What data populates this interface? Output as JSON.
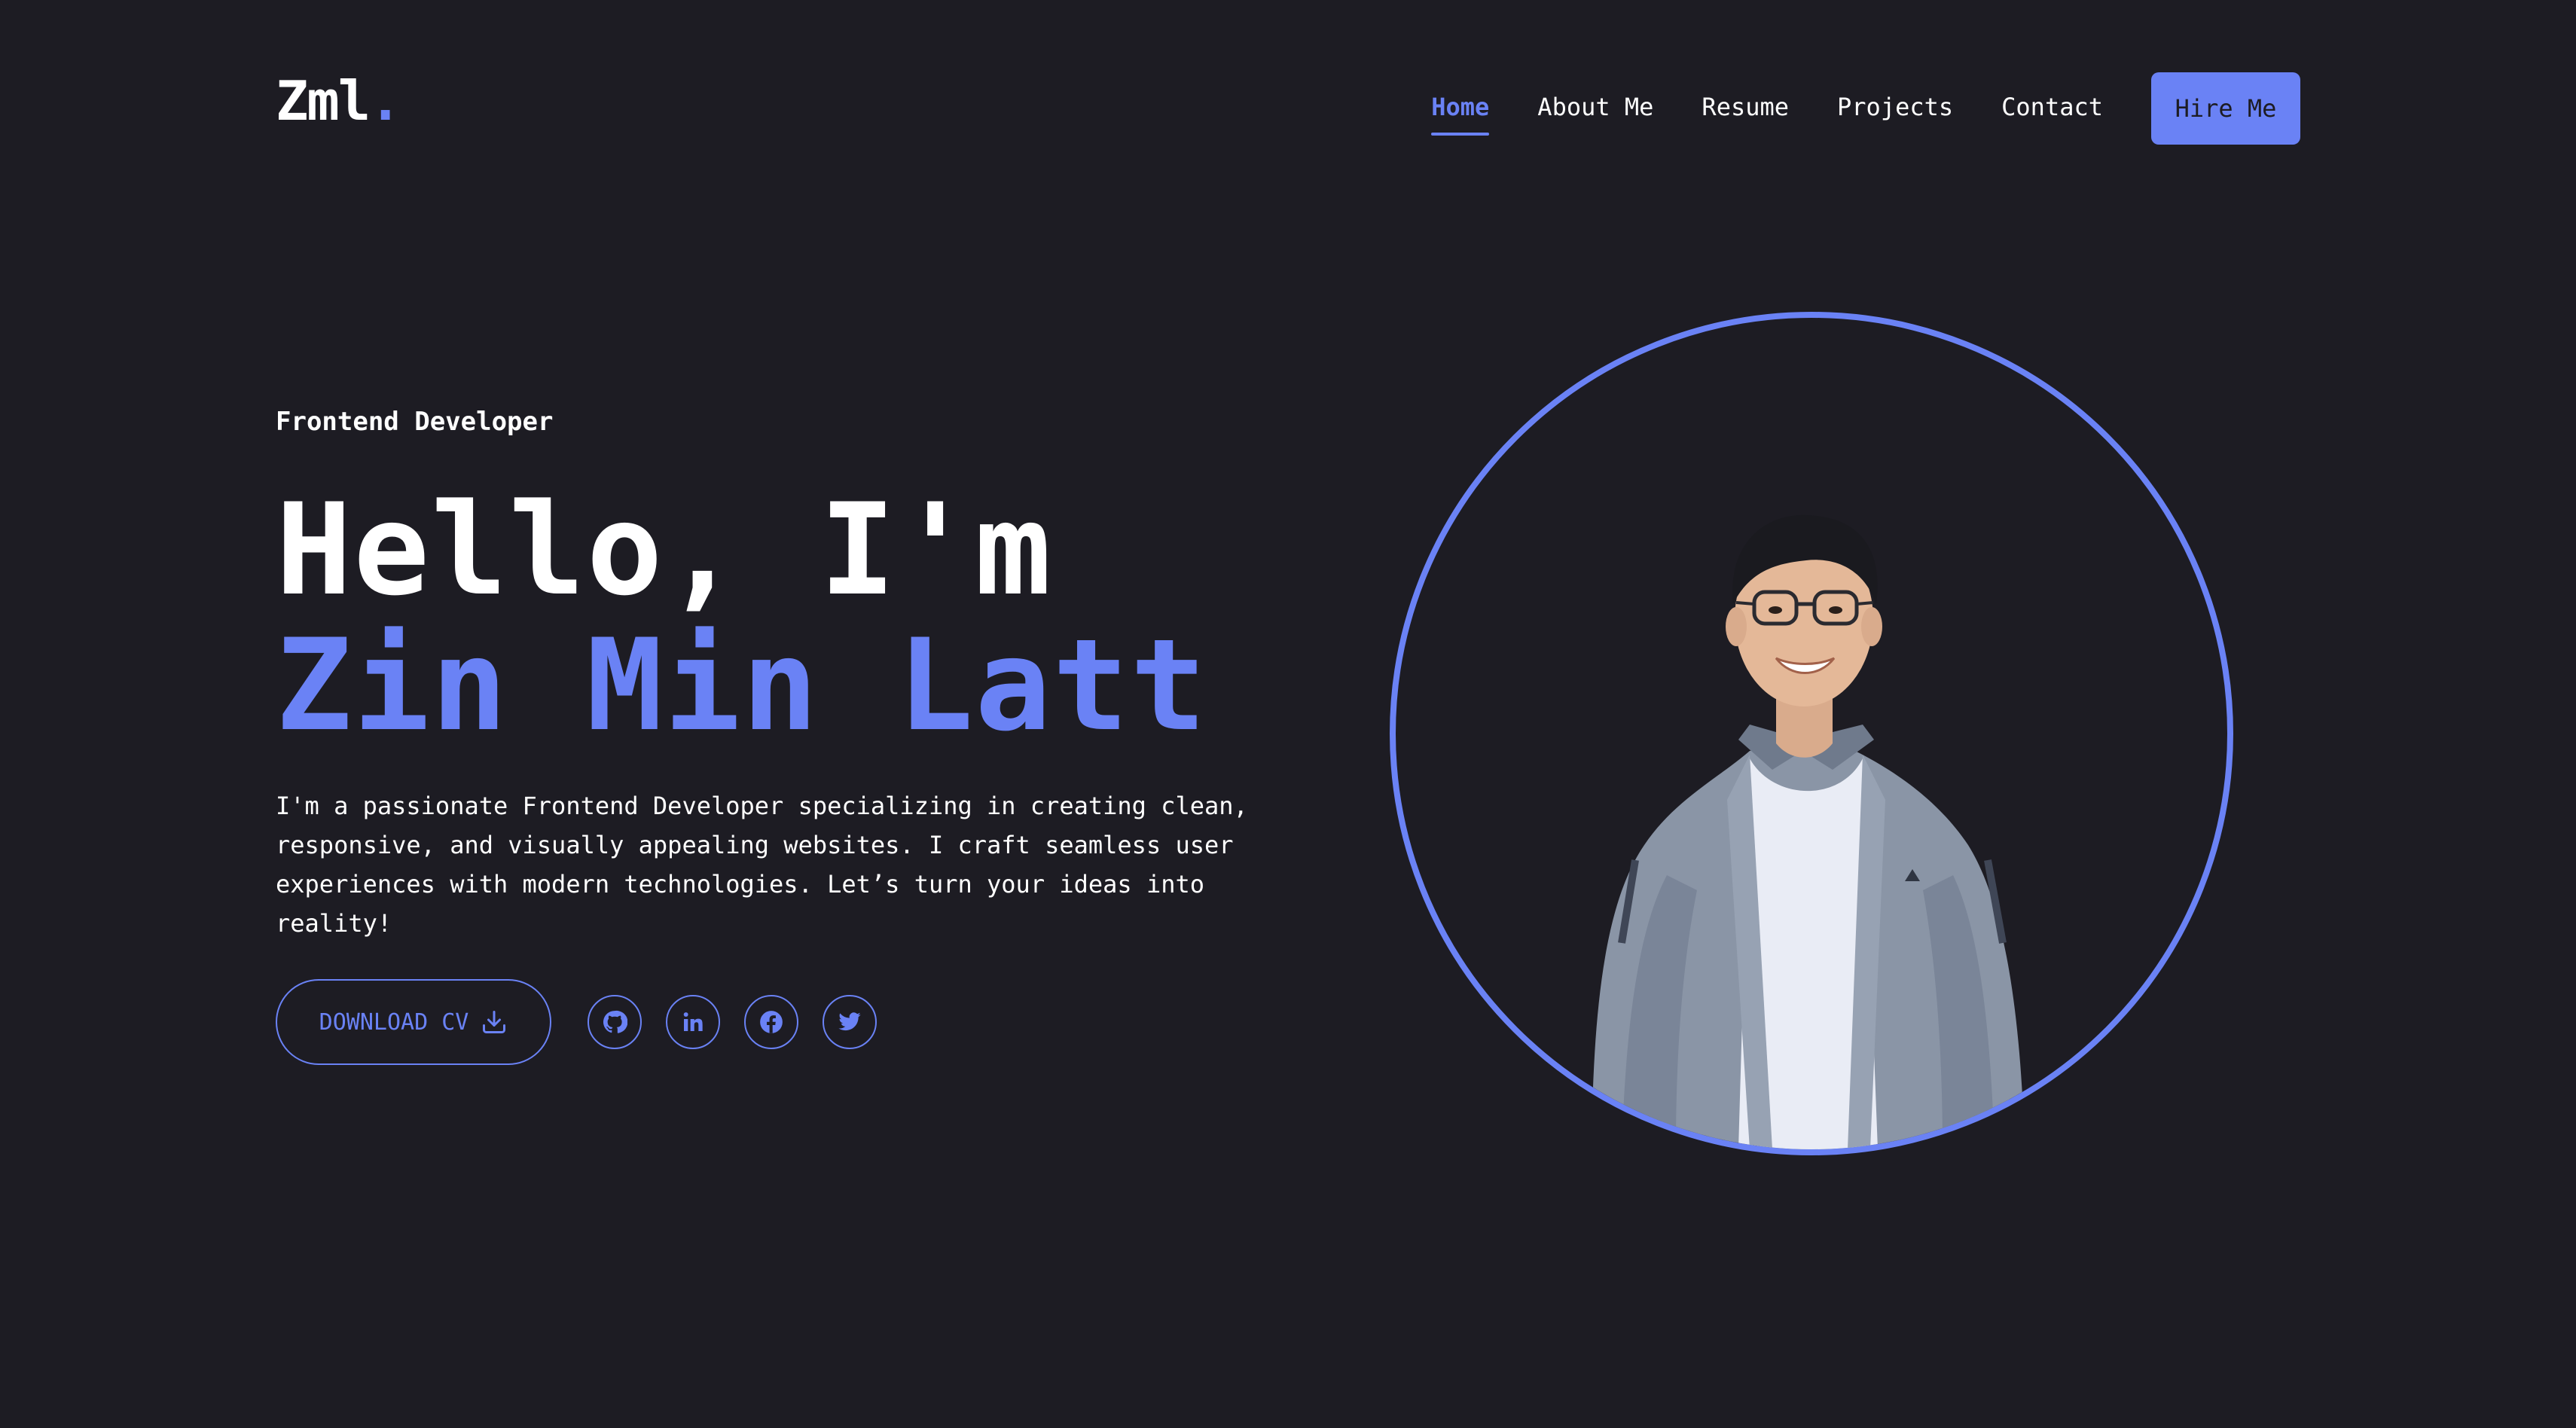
{
  "brand": {
    "name": "Zml",
    "dot": "."
  },
  "nav": {
    "items": [
      {
        "label": "Home",
        "active": true
      },
      {
        "label": "About Me"
      },
      {
        "label": "Resume"
      },
      {
        "label": "Projects"
      },
      {
        "label": "Contact"
      }
    ],
    "cta": "Hire Me"
  },
  "hero": {
    "role": "Frontend Developer",
    "greeting": "Hello, I'm",
    "name": "Zin Min Latt",
    "bio": "I'm a passionate Frontend Developer specializing in creating clean, responsive, and visually appealing websites. I craft seamless user experiences with modern technologies. Let’s turn your ideas into reality!",
    "download_label": "DOWNLOAD CV",
    "download_icon": "download-icon",
    "socials": [
      {
        "icon": "github-icon"
      },
      {
        "icon": "linkedin-icon"
      },
      {
        "icon": "facebook-icon"
      },
      {
        "icon": "twitter-icon"
      }
    ]
  },
  "colors": {
    "background": "#1d1c23",
    "accent": "#6a82f5",
    "text": "#ffffff"
  }
}
